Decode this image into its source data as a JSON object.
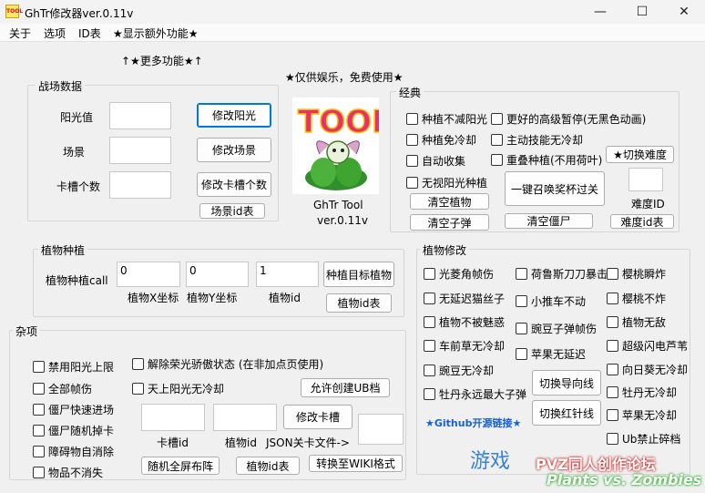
{
  "window": {
    "title": "GhTr修改器ver.0.11v",
    "icon_text": "TOOL",
    "minimize": "—",
    "maximize": "☐",
    "close": "✕"
  },
  "menu": [
    "关于",
    "选项",
    "ID表",
    "★显示额外功能★"
  ],
  "top_links": {
    "more": "↑★更多功能★↑",
    "notice": "★仅供娱乐，免费使用★"
  },
  "battle": {
    "legend": "战场数据",
    "labels": [
      "阳光值",
      "场景",
      "卡槽个数"
    ],
    "buttons": [
      "修改阳光",
      "修改场景",
      "修改卡槽个数",
      "场景id表"
    ]
  },
  "logo": {
    "text": "TOOL",
    "name": "GhTr Tool",
    "version": "ver.0.11v"
  },
  "classic": {
    "legend": "经典",
    "checks": [
      "种植不减阳光",
      "更好的高级暂停(无黑色动画)",
      "种植免冷却",
      "主动技能无冷却",
      "自动收集",
      "重叠种植(不用荷叶)",
      "无视阳光种植"
    ],
    "buttons": {
      "switch_difficulty": "★切换难度",
      "clear_plants": "清空植物",
      "summon": "一键召唤奖杯过关",
      "clear_bullets": "清空子弹",
      "clear_zombies": "清空僵尸",
      "difficulty_table": "难度id表"
    },
    "difficulty_label": "难度ID"
  },
  "planting": {
    "legend": "植物种植",
    "label": "植物种植call",
    "x_value": "0",
    "y_value": "0",
    "id_value": "1",
    "x_label": "植物X坐标",
    "y_label": "植物Y坐标",
    "id_label": "植物id",
    "buttons": {
      "plant": "种植目标植物",
      "id_table": "植物id表"
    }
  },
  "misc": {
    "legend": "杂项",
    "checks_left": [
      "禁用阳光上限",
      "全部帧伤",
      "僵尸快速进场",
      "僵尸随机掉卡",
      "障碍物自消除",
      "物品不消失"
    ],
    "checks_right": [
      "解除荣光骄傲状态 (在非加点页使用)",
      "天上阳光无冷却"
    ],
    "buttons": {
      "allow_ub": "允许创建UB档",
      "modify_card": "修改卡槽",
      "random_layout": "随机全屏布阵",
      "plant_id_table": "植物id表",
      "to_wiki": "转换至WIKI格式"
    },
    "labels": {
      "card_id": "卡槽id",
      "plant_id": "植物id",
      "json": "JSON关卡文件->"
    }
  },
  "plant_mod": {
    "legend": "植物修改",
    "col1": [
      "光菱角帧伤",
      "无延迟猫丝子",
      "植物不被魅惑",
      "车前草无冷却",
      "豌豆无冷却",
      "牡丹永远最大子弹"
    ],
    "col2": [
      "荷鲁斯刀刀暴击",
      "小推车不动",
      "豌豆子弹帧伤",
      "苹果无延迟"
    ],
    "col3": [
      "樱桃瞬炸",
      "樱桃不炸",
      "植物无敌",
      "超级闪电芦苇",
      "向日葵无冷却",
      "牡丹无冷却",
      "苹果无冷却",
      "Ub禁止碎档"
    ],
    "buttons": {
      "guide_line": "切换导向线",
      "red_needle": "切换红针线"
    },
    "github": "★Github开源链接★"
  },
  "watermark": {
    "text1": "游戏",
    "text2": "PVZ同人创作论坛",
    "text3": "Plants vs. Zombies"
  }
}
